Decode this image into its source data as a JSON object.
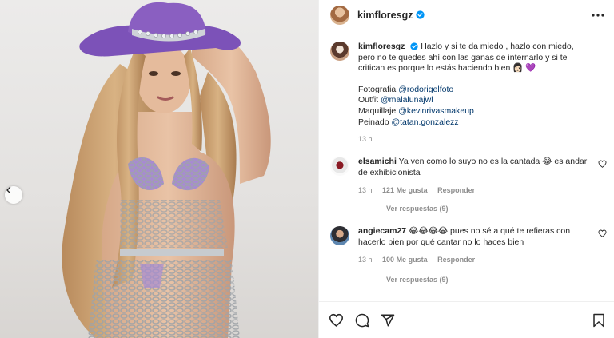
{
  "post": {
    "username": "kimfloresgz",
    "caption": {
      "text": "Hazlo y si te da miedo , hazlo con miedo, pero no te quedes ahí con las ganas de internarlo y si te critican es porque lo estás haciendo bien",
      "credits": [
        {
          "label": "Fotografia",
          "handle": "@rodorigelfoto"
        },
        {
          "label": "Outfit",
          "handle": "@malalunajwl"
        },
        {
          "label": "Maquillaje",
          "handle": "@kevinrivasmakeup"
        },
        {
          "label": "Peinado",
          "handle": "@tatan.gonzalezz"
        }
      ],
      "time": "13 h"
    },
    "comments": [
      {
        "username": "elsamichi",
        "text": "Ya ven como lo suyo no es la cantada 😂 es andar de exhibicionista",
        "time": "13 h",
        "likes": "121 Me gusta",
        "reply": "Responder",
        "view_replies": "Ver respuestas (9)"
      },
      {
        "username": "angiecam27",
        "text": "😂😂😂😂 pues no sé a qué te refieras con hacerlo bien por qué cantar no lo haces bien",
        "time": "13 h",
        "likes": "100 Me gusta",
        "reply": "Responder",
        "view_replies": "Ver respuestas (9)"
      }
    ]
  },
  "icons": {
    "header": [
      "verified-icon",
      "more-options-icon"
    ],
    "actions": [
      "like-icon",
      "comment-icon",
      "share-icon",
      "save-icon"
    ],
    "media": [
      "carousel-prev-icon"
    ]
  },
  "colors": {
    "verified": "#0095f6",
    "mention": "#00376b",
    "muted": "#8e8e8e",
    "hat": "#8a5fc1"
  }
}
